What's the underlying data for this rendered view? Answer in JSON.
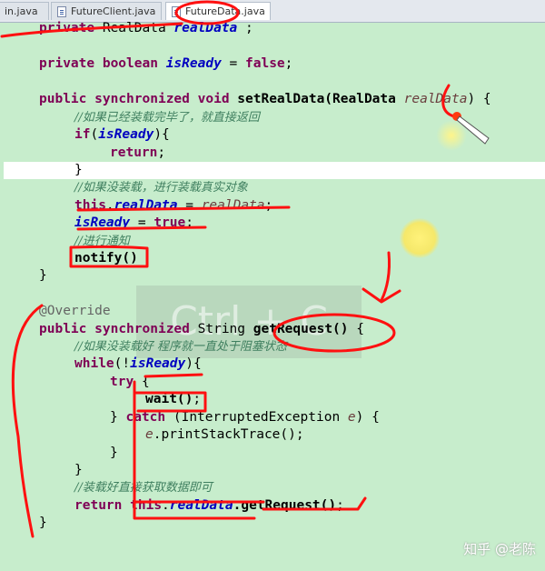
{
  "tabs": [
    {
      "label": "in.java",
      "active": false
    },
    {
      "label": "FutureClient.java",
      "active": false
    },
    {
      "label": "FutureData.java",
      "active": true
    }
  ],
  "code": {
    "line1": {
      "kw": "private",
      "type": "RealData",
      "field": "realData",
      "end": ";"
    },
    "line2": {
      "kw1": "private",
      "kw2": "boolean",
      "field": "isReady",
      "eq": "=",
      "val": "false",
      "end": ";"
    },
    "line3": {
      "kw1": "public",
      "kw2": "synchronized",
      "kw3": "void",
      "name": "setRealData(RealData",
      "param": "realData",
      "end": ") {"
    },
    "line4": {
      "comment": "//如果已经装载完毕了，就直接返回"
    },
    "line5": {
      "kw": "if",
      "open": "(",
      "field": "isReady",
      "close": "){"
    },
    "line6": {
      "kw": "return",
      "end": ";"
    },
    "line7": {
      "text": "}"
    },
    "line8": {
      "comment": "//如果没装载，进行装载真实对象"
    },
    "line9": {
      "kw": "this",
      "dot": ".",
      "field": "realData",
      "eq": " = ",
      "param": "realData",
      "end": ";"
    },
    "line10": {
      "field": "isReady",
      "eq": " = ",
      "kw": "true",
      "end": ";"
    },
    "line11": {
      "comment": "//进行通知"
    },
    "line12": {
      "text": "notify()"
    },
    "line13": {
      "text": "}"
    },
    "line14": {
      "annotation": "@Override"
    },
    "line15": {
      "kw1": "public",
      "kw2": "synchronized",
      "type": "String",
      "name": "getRequest()",
      "end": "{"
    },
    "line16": {
      "comment": "//如果没装载好 程序就一直处于阻塞状态"
    },
    "line17": {
      "kw": "while",
      "open": "(!",
      "field": "isReady",
      "close": "){"
    },
    "line18": {
      "kw": "try",
      "end": "{"
    },
    "line19": {
      "text": "wait()",
      "end": ";"
    },
    "line20": {
      "close": "} ",
      "kw": "catch",
      "rest": "(InterruptedException",
      "param": "e",
      "end": ") {"
    },
    "line21": {
      "param": "e",
      "rest": ".printStackTrace();"
    },
    "line22": {
      "text": "}"
    },
    "line23": {
      "text": "}"
    },
    "line24": {
      "comment": "//装载好直接获取数据即可"
    },
    "line25": {
      "kw1": "return",
      "kw2": "this",
      "dot": ".",
      "field": "realData",
      "rest": ".getRequest()",
      "end": ";"
    },
    "line26": {
      "text": "}"
    }
  },
  "overlay": {
    "watermark": "Ctrl + C"
  },
  "brand": "知乎 @老陈",
  "colors": {
    "background": "#c7edcc",
    "ink": "#ff0000"
  }
}
